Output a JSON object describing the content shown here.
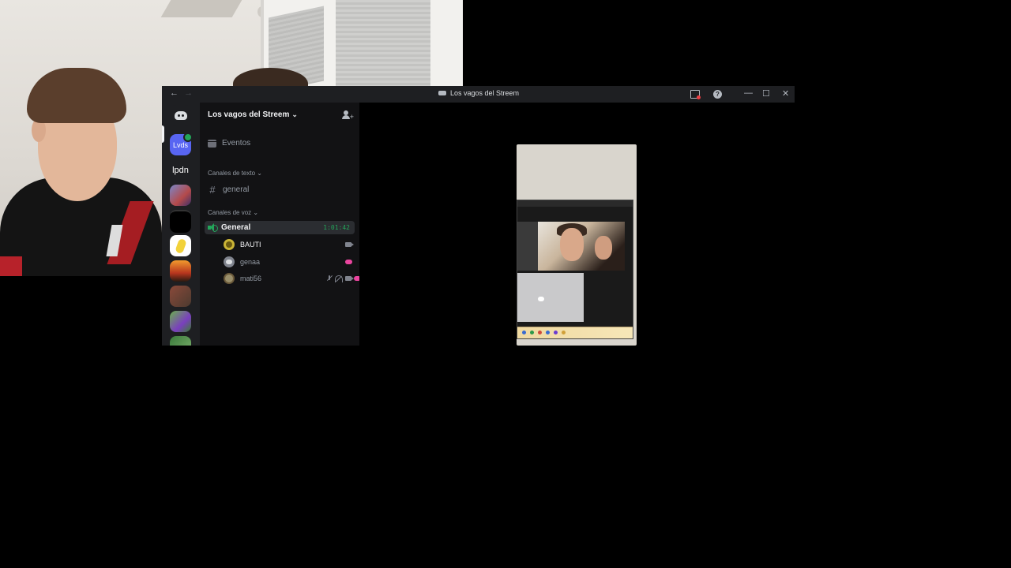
{
  "window": {
    "title": "Los vagos del Streem",
    "back_label": "←",
    "forward_label": "→",
    "help_label": "?",
    "minimize_label": "—",
    "maximize_label": "☐",
    "close_label": "✕"
  },
  "guilds": {
    "lvds_label": "Lvds",
    "lpdn_label": "lpdn"
  },
  "server": {
    "name": "Los vagos del Streem",
    "chevron": "⌄"
  },
  "channels": {
    "events_label": "Eventos",
    "text_category": "Canales de texto",
    "text_channels": [
      {
        "name": "general"
      }
    ],
    "voice_category": "Canales de voz",
    "voice_channel": {
      "name": "General",
      "timer": "1:01:42"
    },
    "members": [
      {
        "name": "BAUTI"
      },
      {
        "name": "genaa"
      },
      {
        "name": "mati56"
      }
    ]
  },
  "colors": {
    "accent": "#5865f2",
    "online": "#23a55a",
    "activity": "#eb459f",
    "background": "#121214"
  }
}
